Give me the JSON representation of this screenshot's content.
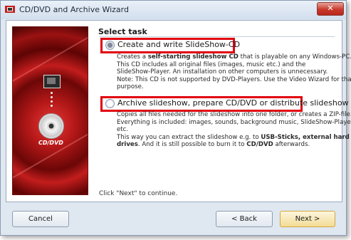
{
  "window": {
    "title": "CD/DVD and Archive Wizard",
    "close_label": "✕"
  },
  "sidebar": {
    "disc_label": "CD/DVD"
  },
  "task": {
    "heading": "Select task",
    "options": [
      {
        "label": "Create and write SlideShow-CD",
        "selected": true,
        "description": [
          [
            "Creates a ",
            "self-starting slideshow CD",
            " that is playable on any Windows-PC."
          ],
          [
            "This CD includes all original files (images, music etc.) and the"
          ],
          [
            "SlideShow-Player. An installation on other computers is unnecessary."
          ],
          [
            "Note: This CD is not supported by DVD-Players. Use the Video Wizard for that"
          ],
          [
            "purpose."
          ]
        ]
      },
      {
        "label": "Archive slideshow, prepare CD/DVD or distribute slideshow",
        "selected": false,
        "description": [
          [
            "Copies all files needed for the slideshow into one folder, or creates a ZIP-file."
          ],
          [
            "Everything is included: images, sounds, background music, SlideShow-Player"
          ],
          [
            "etc."
          ],
          [
            "This way you can extract the slideshow e.g. to ",
            "USB-Sticks, external hard"
          ],
          [
            "drives",
            ". And it is still possible to burn it to ",
            "CD/DVD",
            " afterwards."
          ]
        ]
      }
    ],
    "hint": "Click \"Next\" to continue."
  },
  "buttons": {
    "cancel": "Cancel",
    "back": "< Back",
    "next": "Next >"
  },
  "colors": {
    "highlight": "#e1000f",
    "sidebar_red": "#b51818"
  }
}
